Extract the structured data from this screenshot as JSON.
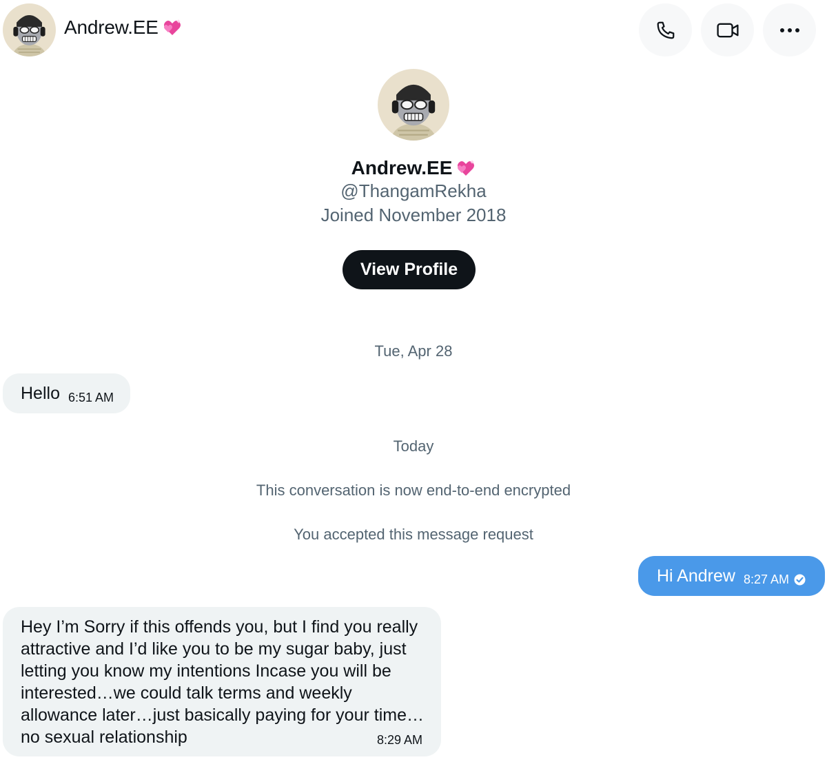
{
  "header": {
    "name": "Andrew.EE",
    "avatar_icon": "ape-avatar-icon",
    "badge_icon": "sparkling-hearts-icon",
    "actions": [
      {
        "name": "call-button",
        "icon": "phone-icon"
      },
      {
        "name": "video-call-button",
        "icon": "video-camera-icon"
      },
      {
        "name": "more-button",
        "icon": "more-dots-icon"
      }
    ]
  },
  "profile": {
    "name": "Andrew.EE",
    "handle": "@ThangamRekha",
    "joined": "Joined November 2018",
    "view_profile_label": "View Profile"
  },
  "conversation": {
    "date_separator_1": "Tue, Apr 28",
    "date_separator_2": "Today",
    "encryption_notice": "This conversation is now end-to-end encrypted",
    "request_notice": "You accepted this message request",
    "messages": [
      {
        "direction": "incoming",
        "text": "Hello",
        "time": "6:51 AM"
      },
      {
        "direction": "outgoing",
        "text": "Hi Andrew",
        "time": "8:27 AM",
        "status_icon": "read-check-icon"
      },
      {
        "direction": "incoming",
        "text": "Hey I’m Sorry if this offends you, but I find you really attractive and I’d like you to be my sugar baby, just letting you know my intentions Incase you will be interested…we could talk terms and weekly allowance later…just basically paying for your time…no sexual relationship",
        "time": "8:29 AM"
      }
    ]
  },
  "colors": {
    "outgoing_bubble": "#4a99e9",
    "incoming_bubble": "#eff3f4",
    "primary_button": "#0f1419",
    "muted_text": "#536471"
  }
}
